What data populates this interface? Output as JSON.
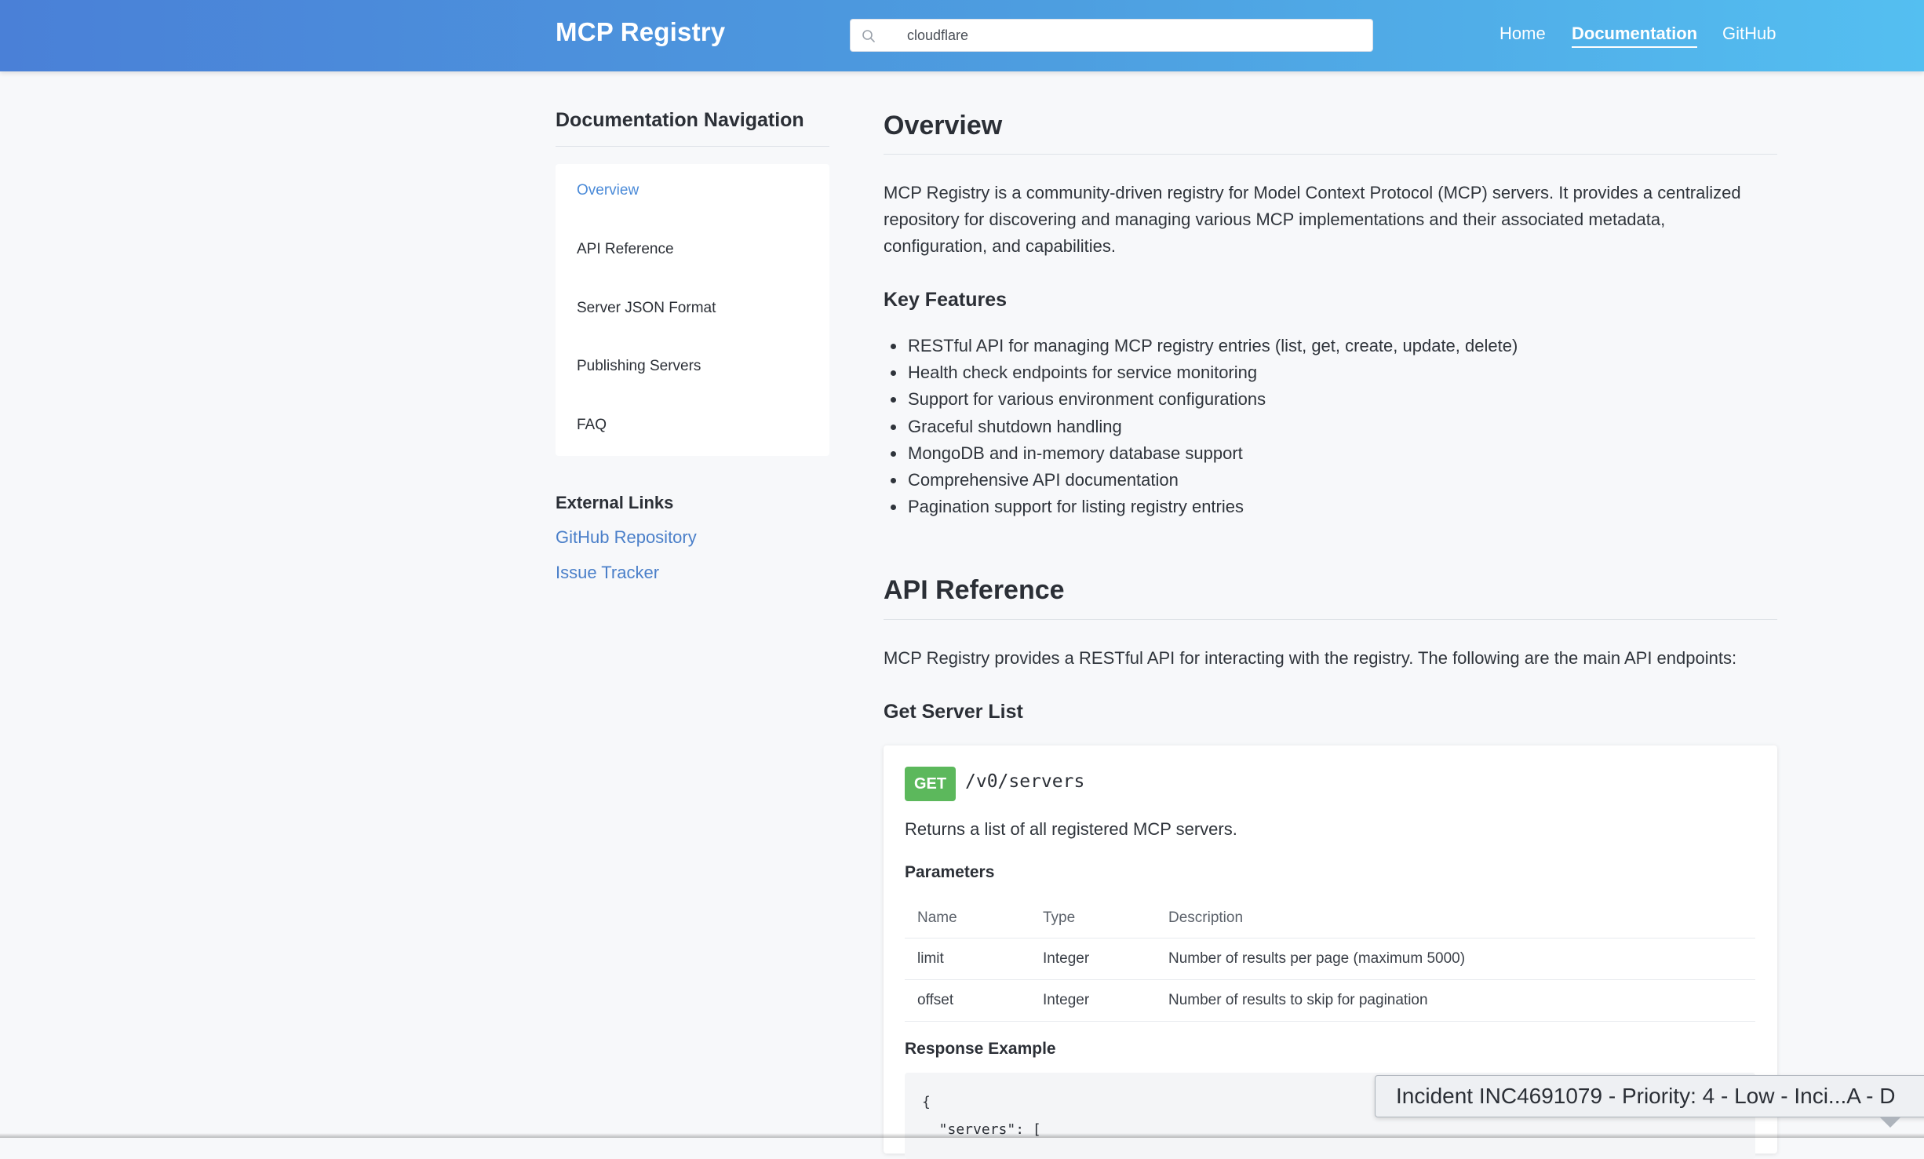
{
  "header": {
    "brand": "MCP Registry",
    "search_value": "cloudflare",
    "nav": {
      "home": "Home",
      "documentation": "Documentation",
      "github": "GitHub"
    },
    "colors": {
      "gradient_start": "#4a80d7",
      "gradient_end": "#54bff1"
    }
  },
  "sidebar": {
    "title": "Documentation Navigation",
    "items": [
      {
        "label": "Overview",
        "active": true
      },
      {
        "label": "API Reference"
      },
      {
        "label": "Server JSON Format"
      },
      {
        "label": "Publishing Servers"
      },
      {
        "label": "FAQ"
      }
    ],
    "external_title": "External Links",
    "external_links": [
      {
        "label": "GitHub Repository"
      },
      {
        "label": "Issue Tracker"
      }
    ]
  },
  "overview": {
    "title": "Overview",
    "intro_lines": [
      "MCP Registry is a community-driven registry for Model Context Protocol (MCP) servers. It provides a centralized",
      "repository for discovering and managing various MCP implementations and their associated metadata,",
      "configuration, and capabilities."
    ],
    "features_title": "Key Features",
    "features": [
      "RESTful API for managing MCP registry entries (list, get, create, update, delete)",
      "Health check endpoints for service monitoring",
      "Support for various environment configurations",
      "Graceful shutdown handling",
      "MongoDB and in-memory database support",
      "Comprehensive API documentation",
      "Pagination support for listing registry entries"
    ]
  },
  "api": {
    "title": "API Reference",
    "intro": "MCP Registry provides a RESTful API for interacting with the registry. The following are the main API endpoints:",
    "endpoint_title": "Get Server List",
    "method": "GET",
    "path": "/v0/servers",
    "description": "Returns a list of all registered MCP servers.",
    "params_title": "Parameters",
    "params_headers": [
      "Name",
      "Type",
      "Description"
    ],
    "params": [
      [
        "limit",
        "Integer",
        "Number of results per page (maximum 5000)"
      ],
      [
        "offset",
        "Integer",
        "Number of results to skip for pagination"
      ]
    ],
    "response_title": "Response Example",
    "response_lines": [
      "{",
      "  \"servers\": ["
    ],
    "method_color": "#5cb85c"
  },
  "toast": {
    "text": "Incident INC4691079 - Priority: 4 - Low - Inci...A - D"
  }
}
